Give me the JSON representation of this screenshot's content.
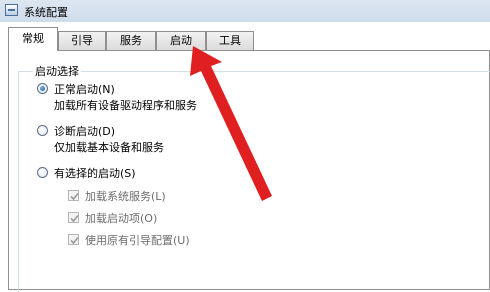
{
  "window": {
    "title": "系统配置"
  },
  "tabs": [
    {
      "label": "常规"
    },
    {
      "label": "引导"
    },
    {
      "label": "服务"
    },
    {
      "label": "启动"
    },
    {
      "label": "工具"
    }
  ],
  "startup_selection": {
    "legend": "启动选择",
    "normal": {
      "label": "正常启动(N)",
      "description": "加载所有设备驱动程序和服务",
      "checked": true
    },
    "diagnostic": {
      "label": "诊断启动(D)",
      "description": "仅加载基本设备和服务",
      "checked": false
    },
    "selective": {
      "label": "有选择的启动(S)",
      "checked": false,
      "options": [
        {
          "label": "加载系统服务(L)",
          "checked": true
        },
        {
          "label": "加载启动项(O)",
          "checked": true
        },
        {
          "label": "使用原有引导配置(U)",
          "checked": true
        }
      ]
    }
  },
  "annotation": {
    "color": "#e02020"
  }
}
